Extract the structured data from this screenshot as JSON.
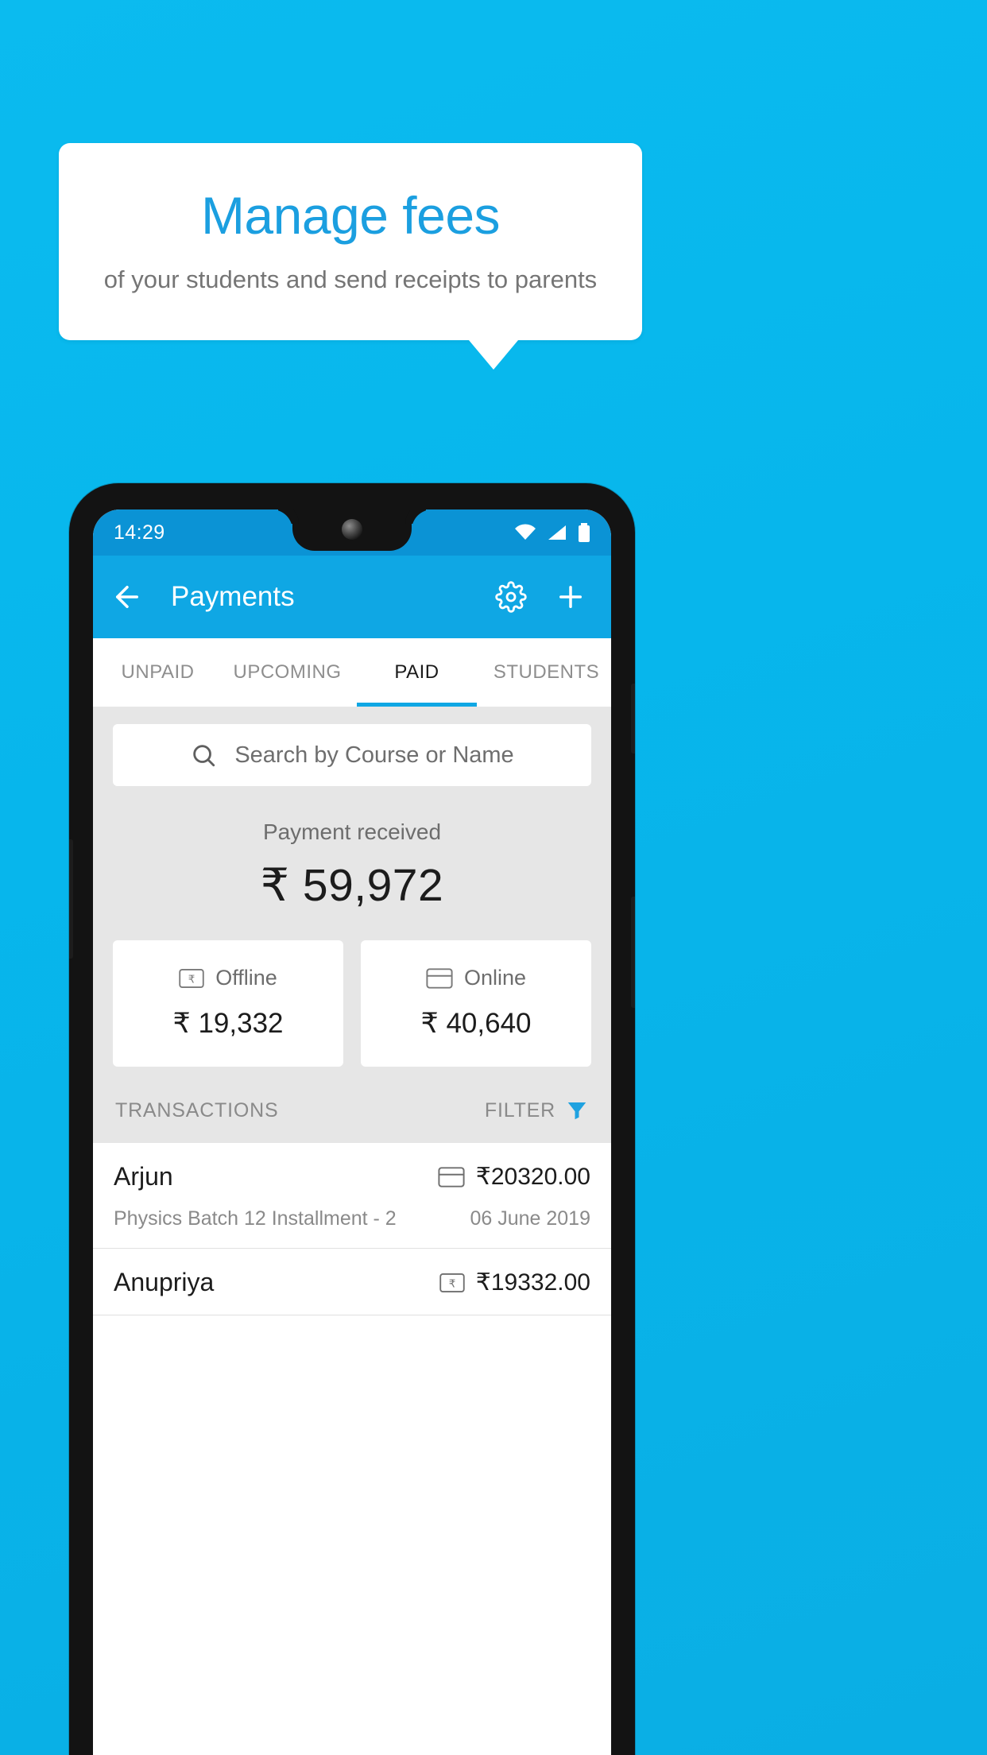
{
  "promo": {
    "title": "Manage fees",
    "subtitle": "of your students and send receipts to parents",
    "background_color": "#0bbbef",
    "title_color": "#1b9fe0",
    "card_color": "#ffffff"
  },
  "phone": {
    "statusbar": {
      "time": "14:29",
      "icons": [
        "wifi-icon",
        "signal-icon",
        "battery-icon"
      ],
      "background_color": "#0b93d5"
    },
    "appbar": {
      "title": "Payments",
      "back_icon": "arrow-left-icon",
      "settings_icon": "gear-icon",
      "add_icon": "plus-icon",
      "background_color": "#0fa7e4"
    },
    "tabs": [
      {
        "label": "UNPAID",
        "active": false
      },
      {
        "label": "UPCOMING",
        "active": false
      },
      {
        "label": "PAID",
        "active": true
      },
      {
        "label": "STUDENTS",
        "active": false
      }
    ],
    "search": {
      "placeholder": "Search by Course or Name",
      "icon": "search-icon",
      "value": ""
    },
    "summary": {
      "label": "Payment received",
      "amount": "₹ 59,972",
      "breakdown": [
        {
          "label": "Offline",
          "amount": "₹ 19,332",
          "icon": "rupee-note-icon"
        },
        {
          "label": "Online",
          "amount": "₹ 40,640",
          "icon": "credit-card-icon"
        }
      ]
    },
    "transactions": {
      "header": "TRANSACTIONS",
      "filter_label": "FILTER",
      "filter_icon": "funnel-icon",
      "rows": [
        {
          "name": "Arjun",
          "description": "Physics Batch 12 Installment - 2",
          "amount": "₹20320.00",
          "date": "06 June 2019",
          "method_icon": "credit-card-icon"
        },
        {
          "name": "Anupriya",
          "description": "",
          "amount": "₹19332.00",
          "date": "",
          "method_icon": "rupee-note-icon"
        }
      ]
    }
  }
}
